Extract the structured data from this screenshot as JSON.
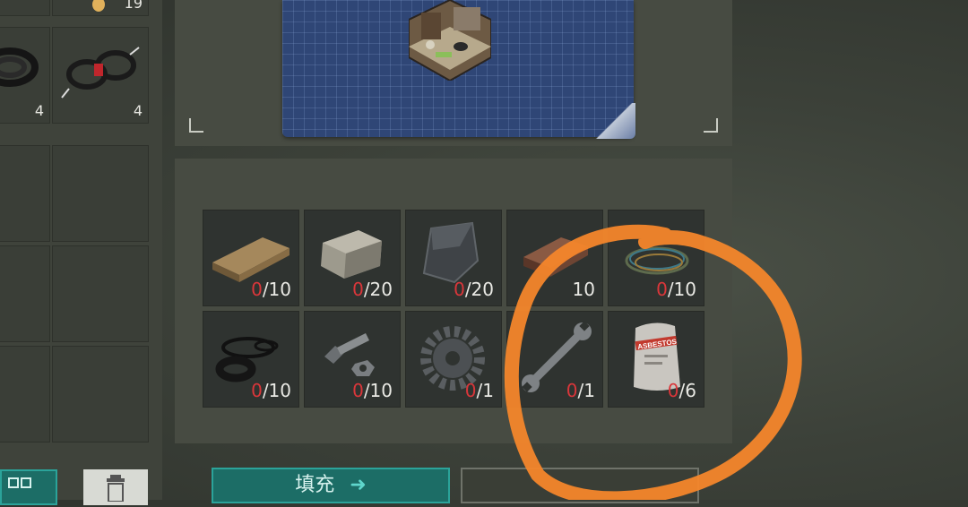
{
  "inventory": {
    "cells": [
      {
        "name": "top-left-item",
        "count": ""
      },
      {
        "name": "egg-item",
        "count": "19"
      },
      {
        "name": "cable-coil-item",
        "count": "4"
      },
      {
        "name": "wire-bundle-item",
        "count": "4"
      }
    ]
  },
  "requirements": {
    "row1": [
      {
        "item": "planks",
        "icon": "wood-plank-icon",
        "have": "0",
        "need": "/10"
      },
      {
        "item": "stone",
        "icon": "stone-block-icon",
        "have": "0",
        "need": "/20"
      },
      {
        "item": "metal-plate",
        "icon": "metal-plate-icon",
        "have": "0",
        "need": "/20"
      },
      {
        "item": "copper-ingot",
        "icon": "copper-ingot-icon",
        "have": "",
        "need": "10"
      },
      {
        "item": "wires",
        "icon": "wire-coil-icon",
        "have": "0",
        "need": "/10"
      }
    ],
    "row2": [
      {
        "item": "rubber-parts",
        "icon": "rubber-seals-icon",
        "have": "0",
        "need": "/10"
      },
      {
        "item": "nails",
        "icon": "bolt-nut-icon",
        "have": "0",
        "need": "/10"
      },
      {
        "item": "gear",
        "icon": "gear-icon",
        "have": "0",
        "need": "/1"
      },
      {
        "item": "wrench",
        "icon": "wrench-icon",
        "have": "0",
        "need": "/1"
      },
      {
        "item": "asbestos",
        "icon": "asbestos-bag-icon",
        "have": "0",
        "need": "/6",
        "bag_label": "ASBESTOS"
      }
    ]
  },
  "buttons": {
    "fill_label": "填充"
  },
  "colors": {
    "accent": "#1c6d66",
    "missing": "#d9363a",
    "annotation": "#f4862b"
  }
}
